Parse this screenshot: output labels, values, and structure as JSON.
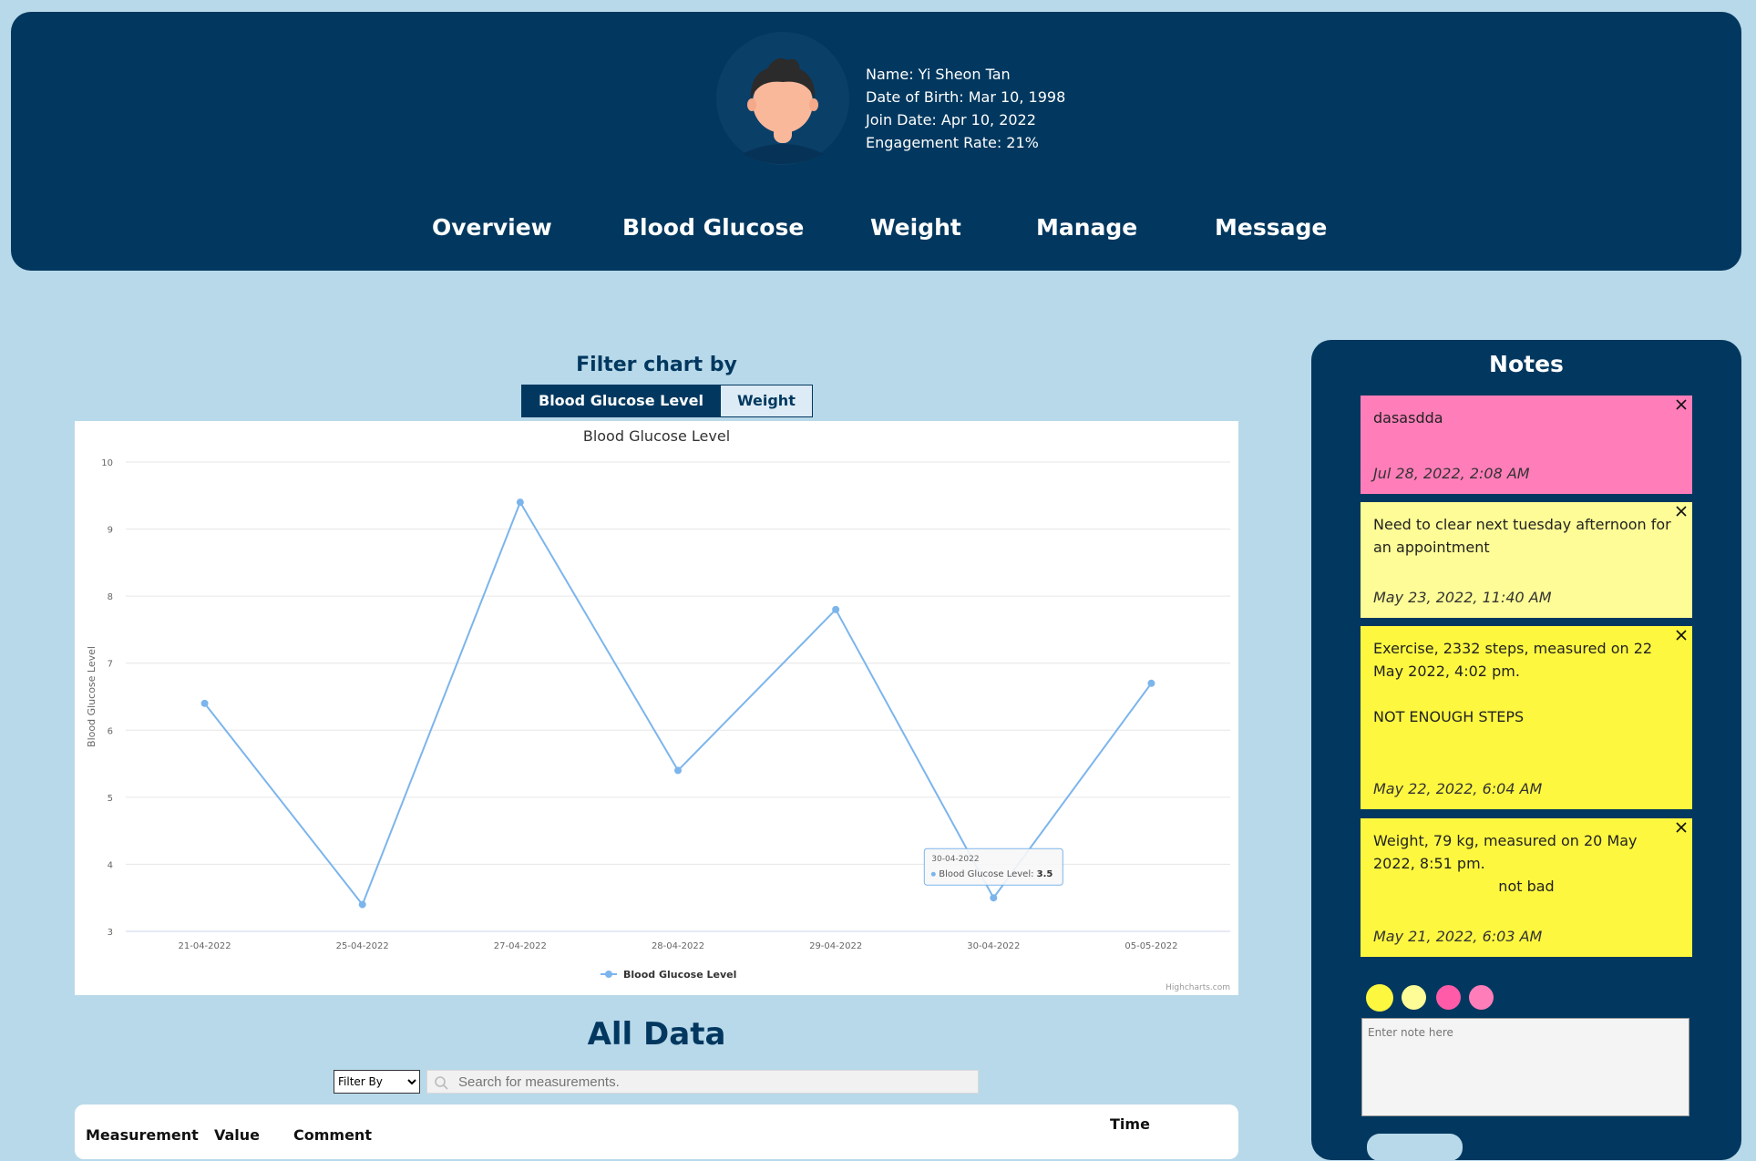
{
  "profile": {
    "name": "Name: Yi Sheon Tan",
    "dob": "Date of Birth: Mar 10, 1998",
    "join": "Join Date: Apr 10, 2022",
    "engagement": "Engagement Rate: 21%"
  },
  "nav": [
    "Overview",
    "Blood Glucose",
    "Weight",
    "Manage",
    "Message"
  ],
  "filter": {
    "title": "Filter chart by",
    "options": [
      "Blood Glucose Level",
      "Weight"
    ],
    "selected": "Blood Glucose Level"
  },
  "chart_data": {
    "type": "line",
    "title": "Blood Glucose Level",
    "xlabel": "",
    "ylabel": "Blood Glucose Level",
    "ylim": [
      3,
      10
    ],
    "yticks": [
      3,
      4,
      5,
      6,
      7,
      8,
      9,
      10
    ],
    "categories": [
      "21-04-2022",
      "25-04-2022",
      "27-04-2022",
      "28-04-2022",
      "29-04-2022",
      "30-04-2022",
      "05-05-2022"
    ],
    "series": [
      {
        "name": "Blood Glucose Level",
        "values": [
          6.4,
          3.4,
          9.4,
          5.4,
          7.8,
          3.5,
          6.7
        ],
        "color": "#7cb5ec"
      }
    ],
    "grid": true,
    "legend_position": "bottom",
    "tooltip": {
      "date": "30-04-2022",
      "label": "Blood Glucose Level: ",
      "value": "3.5"
    },
    "credits": "Highcharts.com"
  },
  "all_data": {
    "title": "All Data",
    "filter_select": "Filter By",
    "search_placeholder": "Search for measurements.",
    "columns": [
      "Measurement",
      "Value",
      "Comment",
      "Time"
    ]
  },
  "notes": {
    "title": "Notes",
    "items": [
      {
        "text": "dasasdda",
        "date": "Jul 28, 2022, 2:08 AM",
        "color": "#ff7eb9"
      },
      {
        "text": "Need to clear next tuesday afternoon for an appointment",
        "date": "May 23, 2022, 11:40 AM",
        "color": "#fdfc96"
      },
      {
        "text": "Exercise, 2332 steps, measured on 22 May 2022, 4:02 pm.",
        "text2": "NOT ENOUGH STEPS",
        "date": "May 22, 2022, 6:04 AM",
        "color": "#fdf73f"
      },
      {
        "text": "Weight, 79 kg, measured on 20 May 2022, 8:51 pm.",
        "text2": "not bad",
        "date": "May 21, 2022, 6:03 AM",
        "color": "#fdf73f"
      }
    ],
    "swatches": [
      "#fdf73f",
      "#fdfc96",
      "#ff5ba8",
      "#ff7eb9"
    ],
    "input_placeholder": "Enter note here"
  }
}
